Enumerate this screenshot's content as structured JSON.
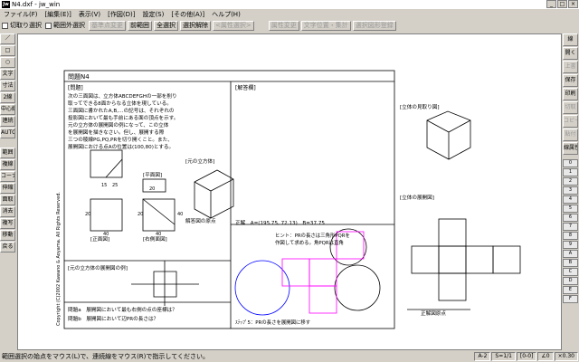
{
  "window": {
    "app_icon": "Jw",
    "title": "N4.dxf - jw_win",
    "controls": [
      "_",
      "□",
      "×"
    ]
  },
  "menu": [
    "ファイル(F)",
    "[編集(E)]",
    "表示(V)",
    "[作図(D)]",
    "設定(S)",
    "[その他(A)]",
    "ヘルプ(H)"
  ],
  "toolbar": {
    "chk1": "切取り選択",
    "chk2": "範囲外選択",
    "buttons": [
      {
        "label": "基準点変更",
        "enabled": false
      },
      {
        "label": "前範囲",
        "enabled": true
      },
      {
        "label": "全選択",
        "enabled": true
      },
      {
        "label": "選択解除",
        "enabled": true
      },
      {
        "label": "<属性選択>",
        "enabled": false
      },
      {
        "label": "属性変更",
        "enabled": false
      },
      {
        "label": "文字位置・集計",
        "enabled": false
      },
      {
        "label": "選択図形登録",
        "enabled": false
      }
    ]
  },
  "left_tools": [
    "／",
    "□",
    "○",
    "文字",
    "寸法",
    "2線",
    "中心線",
    "連続",
    "AUTO",
    "",
    "範囲",
    "複線",
    "コーナー",
    "伸縮",
    "面取",
    "消去",
    "複写",
    "移動",
    "戻る"
  ],
  "right_tools": [
    {
      "label": "線",
      "enabled": true
    },
    {
      "label": "開く",
      "enabled": true
    },
    {
      "label": "上書",
      "enabled": false
    },
    {
      "label": "保存",
      "enabled": true
    },
    {
      "label": "印刷",
      "enabled": true
    },
    {
      "label": "切取",
      "enabled": false
    },
    {
      "label": "コピー",
      "enabled": false
    },
    {
      "label": "貼付",
      "enabled": false
    },
    {
      "label": "線属性",
      "enabled": true
    }
  ],
  "layers": [
    "0",
    "1",
    "2",
    "3",
    "4",
    "5",
    "6",
    "7",
    "8",
    "9",
    "A",
    "B",
    "C",
    "D",
    "E",
    "F"
  ],
  "drawing": {
    "problem_title": "問題N4",
    "problem_tag": "[問題]",
    "problem_text": [
      "次の三面図は、立方体ABCDEFGHの一部を削り",
      "取ってできる8面からなる立体を現している。",
      "三面図に書かれたA,B,…の記号は、それぞれの",
      "投影図において最も手前にある面の頂点を示す。",
      "元の立方体の展開図の例になって、この立体",
      "を展開図を描きなさい。但し、展開する際",
      "三つの稜線PG,PQ,PRを切り開くこと。また、",
      "展開図における点Aの位置は(100,80)とする。"
    ],
    "answer_tag": "[解答欄]",
    "copyright": "Copyright (C)2002 Kawano & Aoyama. All Rights Reserved.",
    "label_plan": "[平面図]",
    "label_front": "[正面図]",
    "label_side": "[右側面図]",
    "label_cube": "[元の立方体]",
    "label_origin": "解答図の原点",
    "answer_line": "正解　A=(195.75, 72.13)　B=37.75",
    "hint1": "ヒント：PRの長さは三角形PQRを",
    "hint2": "作図して求める。角PQRは直角",
    "label_dev_example": "[元の立方体の展開図の例]",
    "step5": "ｽﾃｯﾌﾟ5：PRの長さを展開図に移す",
    "q1": "問題a　展開図において最も右側の点の座標は？",
    "q2": "問題b　展開図において辺PRの長さは？",
    "right_label1": "[立体の見取り図]",
    "right_label2": "[立体の展開図]",
    "right_label3": "正解図原点",
    "dims": [
      "15",
      "25",
      "40",
      "20",
      "40",
      "40",
      "20",
      "20"
    ]
  },
  "status": {
    "message": "範囲選択の始点をマウス(L)で、連続線をマウス(R)で指示してください。",
    "cells": [
      "A-2",
      "S=1/1",
      "[0-0]",
      "∠0",
      "×0.30"
    ]
  }
}
